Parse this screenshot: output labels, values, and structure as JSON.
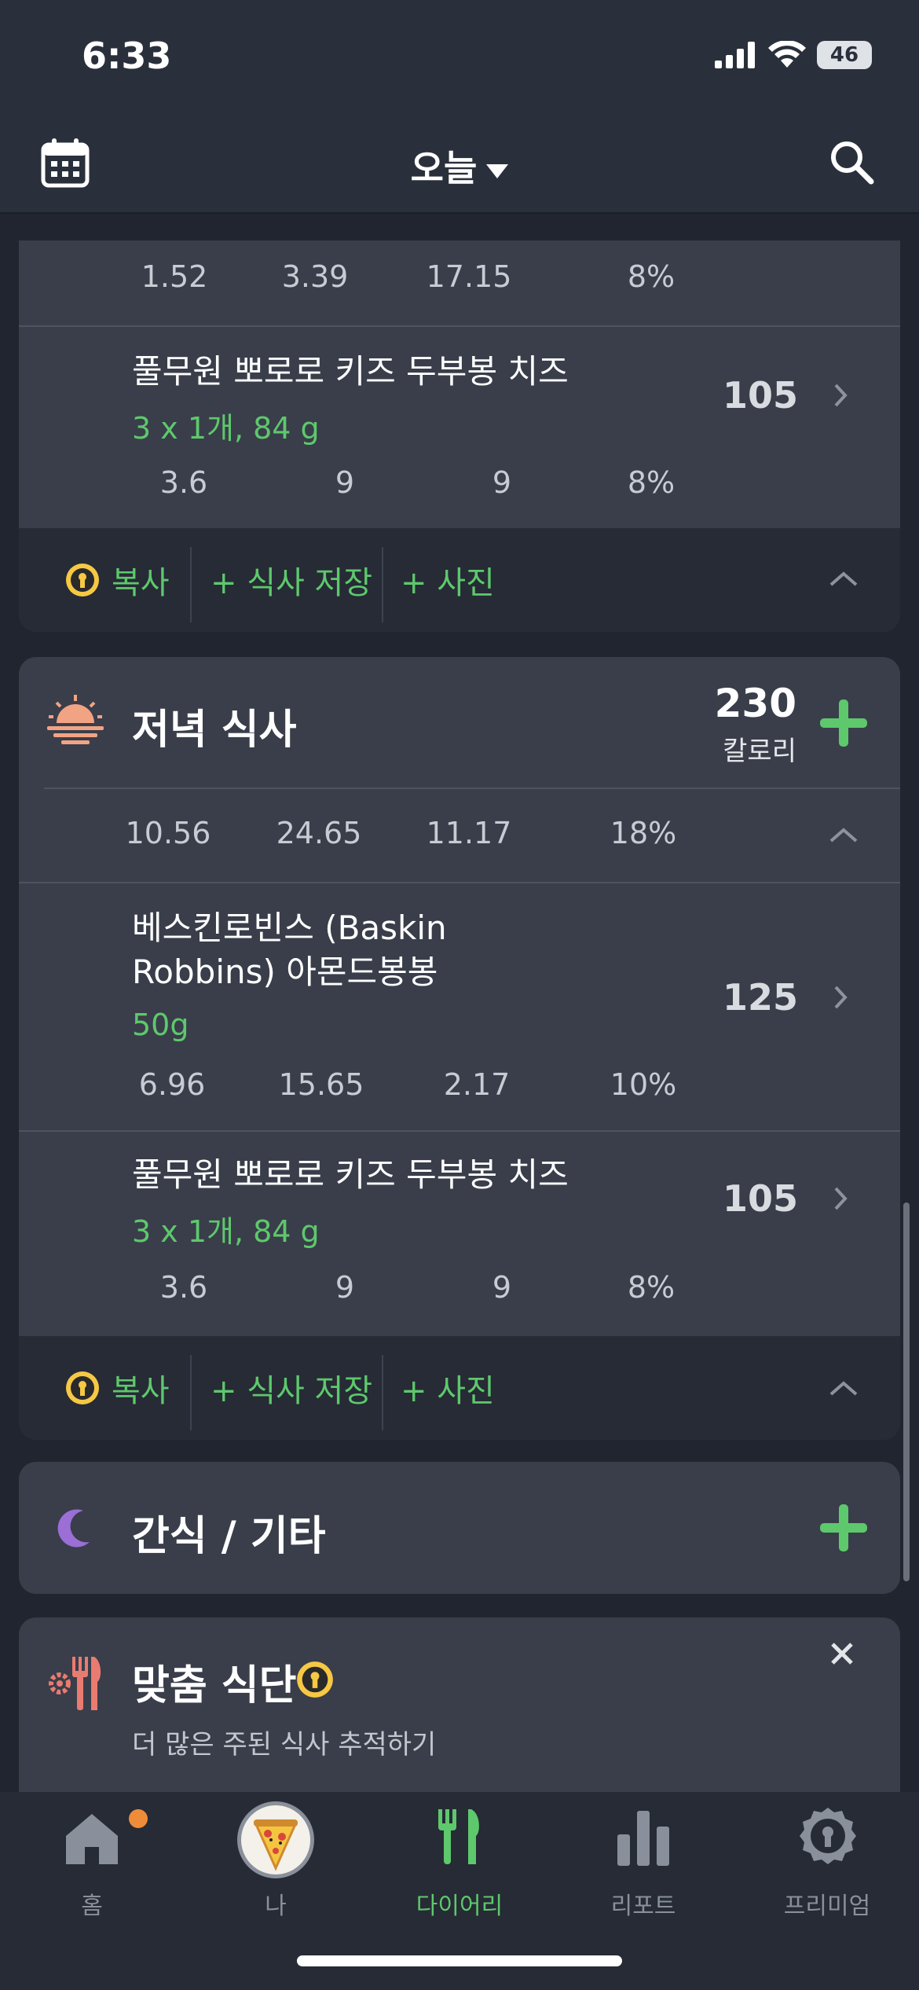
{
  "status": {
    "time": "6:33",
    "battery": "46"
  },
  "header": {
    "title": "오늘"
  },
  "prev_meal": {
    "summary": [
      "1.52",
      "3.39",
      "17.15",
      "8%"
    ],
    "item": {
      "name": "풀무원 뽀로로 키즈 두부봉 치즈",
      "amount": "3 x 1개, 84 g",
      "calories": "105",
      "macros": [
        "3.6",
        "9",
        "9",
        "8%"
      ]
    },
    "footer": {
      "copy": "복사",
      "save": "+ 식사 저장",
      "photo": "+ 사진"
    }
  },
  "dinner": {
    "title": "저녁 식사",
    "calories": "230",
    "calories_unit": "칼로리",
    "summary": [
      "10.56",
      "24.65",
      "11.17",
      "18%"
    ],
    "items": [
      {
        "name_line1": "베스킨로빈스 (Baskin",
        "name_line2": "Robbins) 아몬드봉봉",
        "amount": "50g",
        "calories": "125",
        "macros": [
          "6.96",
          "15.65",
          "2.17",
          "10%"
        ]
      },
      {
        "name_line1": "풀무원 뽀로로 키즈 두부봉 치즈",
        "amount": "3 x 1개, 84 g",
        "calories": "105",
        "macros": [
          "3.6",
          "9",
          "9",
          "8%"
        ]
      }
    ],
    "footer": {
      "copy": "복사",
      "save": "+ 식사 저장",
      "photo": "+ 사진"
    }
  },
  "snack": {
    "title": "간식 / 기타"
  },
  "custom_plan": {
    "title": "맞춤 식단",
    "subtitle": "더 많은 주된 식사 추적하기"
  },
  "tabs": [
    "홈",
    "나",
    "다이어리",
    "리포트",
    "프리미엄"
  ],
  "colors": {
    "accent_green": "#5ec86c",
    "card": "#393e4a",
    "background": "#20252f",
    "sunset": "#f2a383",
    "moon": "#9b6fd6",
    "premium_gold": "#f6c844"
  }
}
